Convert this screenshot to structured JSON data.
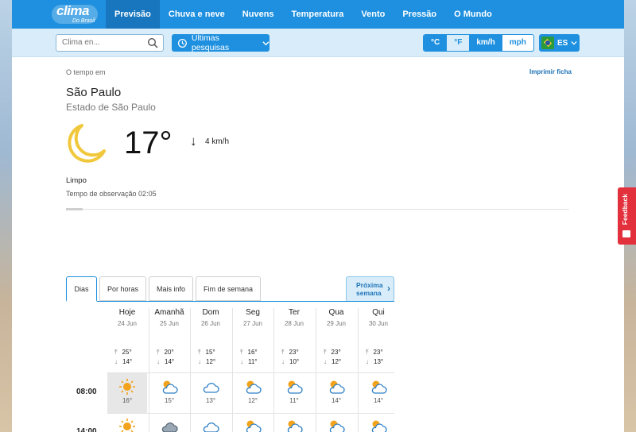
{
  "brand": {
    "name": "clima",
    "sub": "Do Brasil"
  },
  "nav": [
    "Previsão",
    "Chuva e neve",
    "Nuvens",
    "Temperatura",
    "Vento",
    "Pressão",
    "O Mundo"
  ],
  "toolbar": {
    "search_placeholder": "Clima en...",
    "recent_label": "Últimas pesquisas",
    "units": [
      "°C",
      "°F",
      "km/h",
      "mph"
    ],
    "lang": "ES"
  },
  "current": {
    "eyebrow": "O tempo em",
    "print": "Imprimir ficha",
    "city": "São Paulo",
    "state": "Estado de São Paulo",
    "temp": "17°",
    "wind": "4 km/h",
    "condition": "Limpo",
    "observation": "Tempo de observação 02:05"
  },
  "tabs": [
    "Dias",
    "Por horas",
    "Mais info",
    "Fim de semana"
  ],
  "next_label": "Próxima semana",
  "days": [
    {
      "name": "Hoje",
      "date": "24 Jun",
      "max": "25°",
      "min": "14°"
    },
    {
      "name": "Amanhã",
      "date": "25 Jun",
      "max": "20°",
      "min": "14°"
    },
    {
      "name": "Dom",
      "date": "26 Jun",
      "max": "15°",
      "min": "12°"
    },
    {
      "name": "Seg",
      "date": "27 Jun",
      "max": "16°",
      "min": "11°"
    },
    {
      "name": "Ter",
      "date": "28 Jun",
      "max": "23°",
      "min": "10°"
    },
    {
      "name": "Qua",
      "date": "29 Jun",
      "max": "23°",
      "min": "12°"
    },
    {
      "name": "Qui",
      "date": "30 Jun",
      "max": "23°",
      "min": "13°"
    }
  ],
  "hours": [
    {
      "time": "08:00",
      "temps": [
        "16°",
        "15°",
        "13°",
        "12°",
        "11°",
        "14°",
        "14°"
      ],
      "icons": [
        "sun-icon",
        "partly-cloudy-icon",
        "cloud-icon",
        "partly-cloudy-icon",
        "partly-cloudy-icon",
        "partly-cloudy-icon",
        "partly-cloudy-icon"
      ]
    },
    {
      "time": "14:00",
      "temps": [
        "",
        "",
        "",
        "",
        "",
        "",
        ""
      ],
      "icons": [
        "sun-icon",
        "overcast-icon",
        "cloud-icon",
        "partly-cloudy-icon",
        "partly-cloudy-icon",
        "partly-cloudy-icon",
        "partly-cloudy-icon"
      ]
    }
  ],
  "feedback": "Feedback",
  "colors": {
    "primary": "#1e90df",
    "moon": "#f1c83c",
    "sun": "#f2a31b",
    "alert": "#e2313d"
  }
}
